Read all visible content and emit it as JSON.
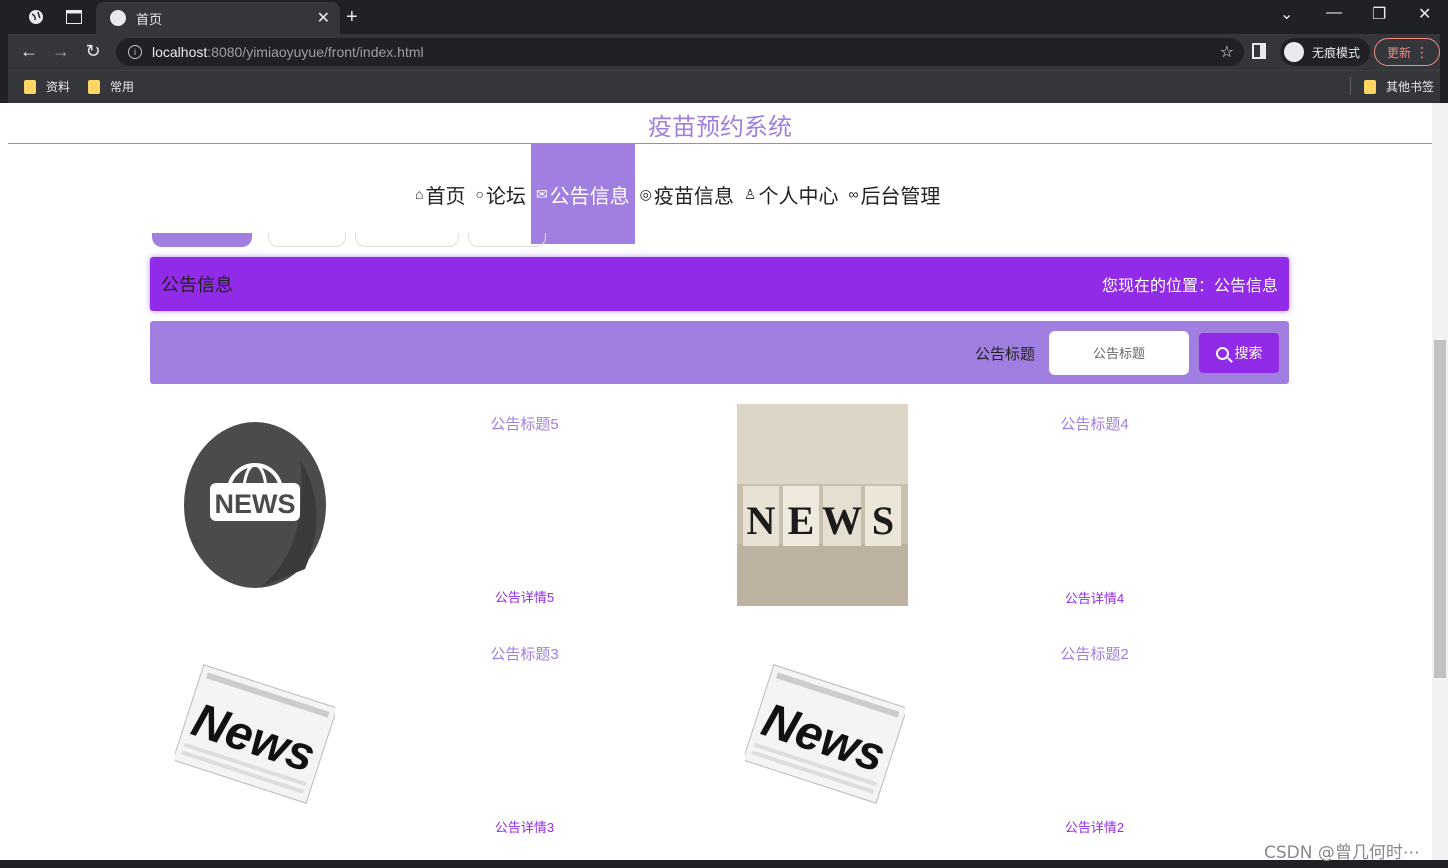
{
  "browser": {
    "tab_title": "首页",
    "url_host": "localhost",
    "url_path": ":8080/yimiaoyuyue/front/index.html",
    "incognito_label": "无痕模式",
    "update_label": "更新",
    "bookmarks": [
      "资料",
      "常用"
    ],
    "other_bookmarks": "其他书签"
  },
  "site": {
    "title": "疫苗预约系统",
    "nav": [
      {
        "label": "首页",
        "icon": "home-icon"
      },
      {
        "label": "论坛",
        "icon": "chat-icon"
      },
      {
        "label": "公告信息",
        "icon": "mail-icon"
      },
      {
        "label": "疫苗信息",
        "icon": "palette-icon"
      },
      {
        "label": "个人中心",
        "icon": "user-icon"
      },
      {
        "label": "后台管理",
        "icon": "link-icon"
      }
    ],
    "active_nav": "公告信息"
  },
  "header_bar": {
    "title": "公告信息",
    "position": "您现在的位置：公告信息"
  },
  "search": {
    "label": "公告标题",
    "placeholder": "公告标题",
    "button": "搜索"
  },
  "news": [
    {
      "title": "公告标题5",
      "detail": "公告详情5",
      "image": "news-globe-image"
    },
    {
      "title": "公告标题4",
      "detail": "公告详情4",
      "image": "news-blocks-image"
    },
    {
      "title": "公告标题3",
      "detail": "公告详情3",
      "image": "newspaper-image"
    },
    {
      "title": "公告标题2",
      "detail": "公告详情2",
      "image": "newspaper-image"
    }
  ],
  "colors": {
    "accent": "#a17fe0",
    "primary": "#922be7"
  },
  "watermark": "CSDN @曾几何时⋯"
}
